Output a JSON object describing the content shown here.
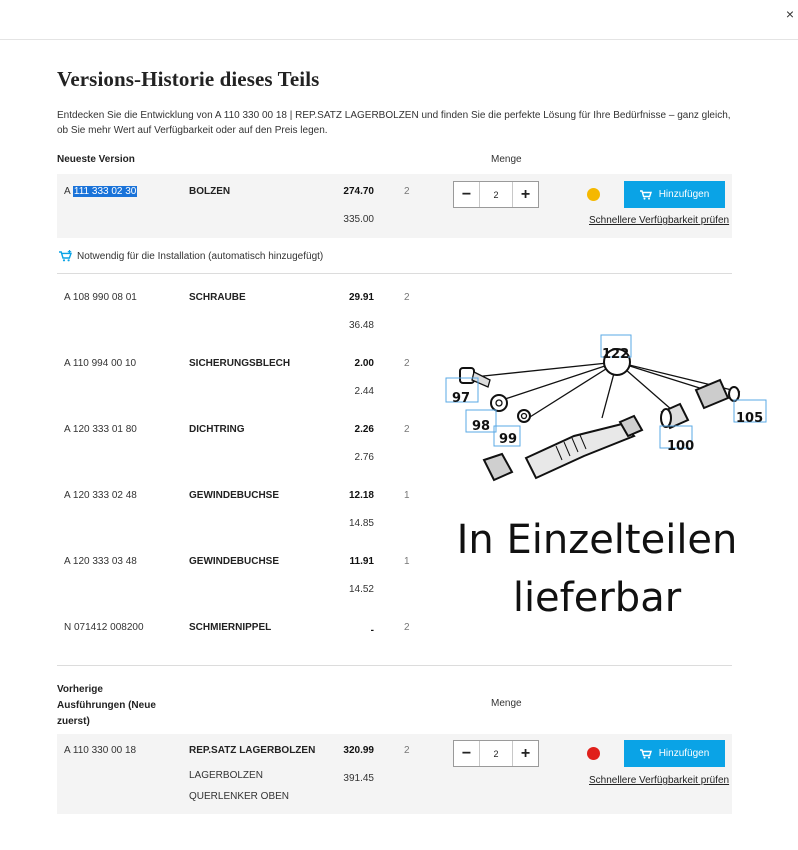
{
  "close_label": "×",
  "title": "Versions-Historie dieses Teils",
  "intro": "Entdecken Sie die Entwicklung von A 110 330 00 18 | REP.SATZ LAGERBOLZEN und finden Sie die perfekte Lösung für Ihre Bedürfnisse – ganz gleich, ob Sie mehr Wert auf Verfügbarkeit oder auf den Preis legen.",
  "newest": {
    "label": "Neueste Version",
    "menge_label": "Menge",
    "part_prefix": "A",
    "part_highlight": "111 333 02 30",
    "name": "BOLZEN",
    "price": "274.70",
    "price2": "335.00",
    "qty_fixed": "2",
    "stepper_value": "2",
    "availability_color": "#f5b800",
    "add_label": "Hinzufügen",
    "avail_link": "Schnellere Verfügbarkeit prüfen"
  },
  "install_note": "Notwendig für die Installation (automatisch hinzugefügt)",
  "components": [
    {
      "part": "A 108 990 08 01",
      "name": "SCHRAUBE",
      "price": "29.91",
      "price2": "36.48",
      "qty": "2"
    },
    {
      "part": "A 110 994 00 10",
      "name": "SICHERUNGSBLECH",
      "price": "2.00",
      "price2": "2.44",
      "qty": "2"
    },
    {
      "part": "A 120 333 01 80",
      "name": "DICHTRING",
      "price": "2.26",
      "price2": "2.76",
      "qty": "2"
    },
    {
      "part": "A 120 333 02 48",
      "name": "GEWINDEBUCHSE",
      "price": "12.18",
      "price2": "14.85",
      "qty": "1"
    },
    {
      "part": "A 120 333 03 48",
      "name": "GEWINDEBUCHSE",
      "price": "11.91",
      "price2": "14.52",
      "qty": "1"
    },
    {
      "part": "N 071412 008200",
      "name": "SCHMIERNIPPEL",
      "price": "-",
      "price2": "",
      "qty": "2"
    }
  ],
  "diagram_labels": [
    "122",
    "97",
    "98",
    "99",
    "100",
    "105"
  ],
  "big_text_line1": "In Einzelteilen",
  "big_text_line2": "lieferbar",
  "previous": {
    "label": "Vorherige Ausführungen (Neue zuerst)",
    "menge_label": "Menge",
    "part": "A 110 330 00 18",
    "name": "REP.SATZ LAGERBOLZEN",
    "sub1": "LAGERBOLZEN",
    "sub2": "QUERLENKER OBEN",
    "price": "320.99",
    "price2": "391.45",
    "qty_fixed": "2",
    "stepper_value": "2",
    "availability_color": "#e0201b",
    "add_label": "Hinzufügen",
    "avail_link": "Schnellere Verfügbarkeit prüfen"
  },
  "icons": {
    "close": "close-icon",
    "minus": "minus-icon",
    "plus": "plus-icon",
    "cart": "cart-icon",
    "cart_add": "cart-plus-icon"
  }
}
